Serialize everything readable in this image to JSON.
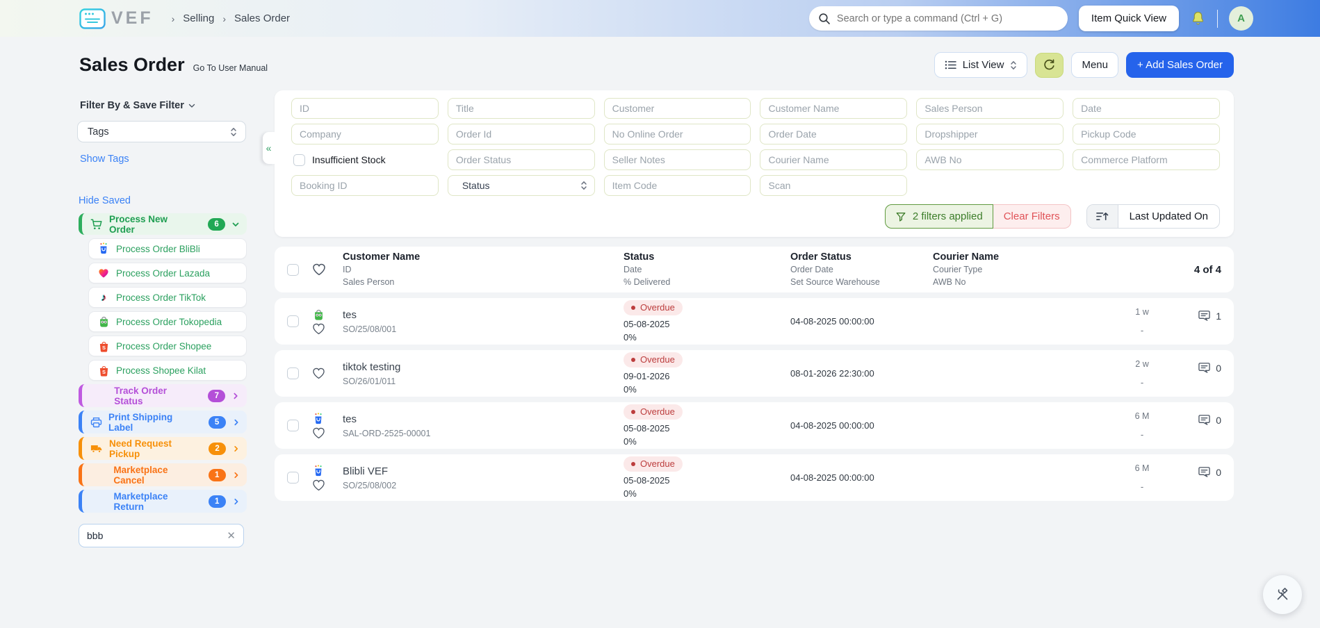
{
  "navbar": {
    "logo_text": "VEF",
    "breadcrumb": [
      "Selling",
      "Sales Order"
    ],
    "search_placeholder": "Search or type a command (Ctrl + G)",
    "item_quick_view_label": "Item Quick View",
    "avatar_initial": "A"
  },
  "page_header": {
    "title": "Sales Order",
    "manual_link": "Go To User Manual",
    "view_selector_label": "List View",
    "menu_label": "Menu",
    "add_button_label": "+ Add Sales Order"
  },
  "sidebar": {
    "filter_heading": "Filter By & Save Filter",
    "tags_select_value": "Tags",
    "show_tags_label": "Show Tags",
    "hide_saved_label": "Hide Saved",
    "saved": [
      {
        "label": "Process New Order",
        "count": "6"
      },
      {
        "label": "Process Order BliBli"
      },
      {
        "label": "Process Order Lazada"
      },
      {
        "label": "Process Order TikTok"
      },
      {
        "label": "Process Order Tokopedia"
      },
      {
        "label": "Process Order Shopee"
      },
      {
        "label": "Process Shopee Kilat"
      },
      {
        "label": "Track Order Status",
        "count": "7"
      },
      {
        "label": "Print Shipping Label",
        "count": "5"
      },
      {
        "label": "Need Request Pickup",
        "count": "2"
      },
      {
        "label": "Marketplace Cancel",
        "count": "1"
      },
      {
        "label": "Marketplace Return",
        "count": "1"
      }
    ],
    "search_value": "bbb"
  },
  "filters": {
    "placeholders": [
      "ID",
      "Title",
      "Customer",
      "Customer Name",
      "Sales Person",
      "Date",
      "Company",
      "Order Id",
      "No Online Order",
      "Order Date",
      "Dropshipper",
      "Pickup Code",
      "Order Status",
      "Seller Notes",
      "Courier Name",
      "AWB No",
      "Commerce Platform",
      "Booking ID",
      "Item Code",
      "Scan"
    ],
    "insufficient_stock_label": "Insufficient Stock",
    "status_select_value": "Status",
    "collapse_glyph": "«",
    "applied_label": "2 filters applied",
    "clear_label": "Clear Filters",
    "sort_label": "Last Updated On"
  },
  "table": {
    "header": {
      "col1": {
        "title": "Customer Name",
        "sub1": "ID",
        "sub2": "Sales Person"
      },
      "col2": {
        "title": "Status",
        "sub1": "Date",
        "sub2": "% Delivered"
      },
      "col3": {
        "title": "Order Status",
        "sub1": "Order Date",
        "sub2": "Set Source Warehouse"
      },
      "col4": {
        "title": "Courier Name",
        "sub1": "Courier Type",
        "sub2": "AWB No"
      },
      "count": "4 of 4"
    },
    "rows": [
      {
        "platform": "tokopedia",
        "customer_name": "tes",
        "id": "SO/25/08/001",
        "status": "Overdue",
        "date": "05-08-2025",
        "delivered": "0%",
        "order_date": "04-08-2025 00:00:00",
        "modified": "1 w",
        "assigned": "-",
        "comments": "1"
      },
      {
        "platform": "",
        "customer_name": "tiktok testing",
        "id": "SO/26/01/011",
        "status": "Overdue",
        "date": "09-01-2026",
        "delivered": "0%",
        "order_date": "08-01-2026 22:30:00",
        "modified": "2 w",
        "assigned": "-",
        "comments": "0"
      },
      {
        "platform": "blibli",
        "customer_name": "tes",
        "id": "SAL-ORD-2525-00001",
        "status": "Overdue",
        "date": "05-08-2025",
        "delivered": "0%",
        "order_date": "04-08-2025 00:00:00",
        "modified": "6 M",
        "assigned": "-",
        "comments": "0"
      },
      {
        "platform": "blibli",
        "customer_name": "Blibli VEF",
        "id": "SO/25/08/002",
        "status": "Overdue",
        "date": "05-08-2025",
        "delivered": "0%",
        "order_date": "04-08-2025 00:00:00",
        "modified": "6 M",
        "assigned": "-",
        "comments": "0"
      }
    ]
  },
  "icons": {
    "logo": "browser-window",
    "search": "magnifier",
    "notifications": "bell",
    "list_view": "list-bullets",
    "refresh": "circular-arrow",
    "process_new_order": "shopping-cart",
    "blibli": "blue-shopping-bag",
    "lazada": "gradient-heart",
    "tiktok": "music-note",
    "tokopedia": "green-bag-owl",
    "shopee": "orange-bag-s",
    "print_shipping_label": "printer",
    "need_request_pickup": "truck",
    "filters_applied": "funnel",
    "sort": "lines-arrow-up",
    "comments": "speech-bubble",
    "favorite": "heart-outline",
    "fab": "crossed-tools"
  },
  "colors": {
    "accent_blue": "#2563eb",
    "brand_cyan": "#35c8dd",
    "green": "#1f9e52",
    "purple": "#b44fd8",
    "orange": "#f79009",
    "overdue_red": "#bc3d3d",
    "refresh_bg": "#d8e494"
  }
}
